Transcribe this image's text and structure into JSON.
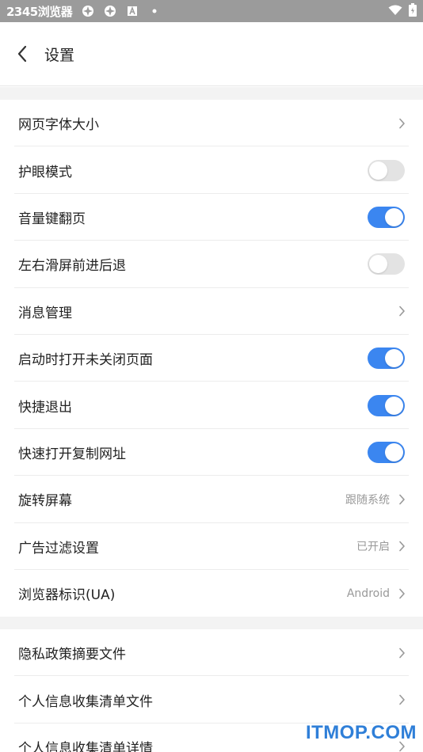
{
  "status_bar": {
    "time": "2345浏览器",
    "icons": [
      "pinwheel-icon",
      "pinwheel-icon",
      "a-badge-icon",
      "dot-icon"
    ],
    "right_icons": [
      "wifi-icon",
      "battery-icon"
    ]
  },
  "header": {
    "title": "设置",
    "back_icon": "chevron-left-icon"
  },
  "section1": [
    {
      "label": "网页字体大小",
      "type": "nav"
    },
    {
      "label": "护眼模式",
      "type": "toggle",
      "on": false
    },
    {
      "label": "音量键翻页",
      "type": "toggle",
      "on": true
    },
    {
      "label": "左右滑屏前进后退",
      "type": "toggle",
      "on": false
    },
    {
      "label": "消息管理",
      "type": "nav"
    },
    {
      "label": "启动时打开未关闭页面",
      "type": "toggle",
      "on": true
    },
    {
      "label": "快捷退出",
      "type": "toggle",
      "on": true
    },
    {
      "label": "快速打开复制网址",
      "type": "toggle",
      "on": true
    },
    {
      "label": "旋转屏幕",
      "type": "nav",
      "value": "跟随系统"
    },
    {
      "label": "广告过滤设置",
      "type": "nav",
      "value": "已开启"
    },
    {
      "label": "浏览器标识(UA)",
      "type": "nav",
      "value": "Android"
    }
  ],
  "section2": [
    {
      "label": "隐私政策摘要文件",
      "type": "nav"
    },
    {
      "label": "个人信息收集清单文件",
      "type": "nav"
    },
    {
      "label": "个人信息收集清单详情",
      "type": "nav"
    }
  ],
  "watermark": "ITMOP.COM",
  "colors": {
    "accent": "#3b86f0",
    "toggle_off": "#e3e3e3",
    "status_bar": "#9b9b9b",
    "watermark": "#2f7fd8"
  }
}
